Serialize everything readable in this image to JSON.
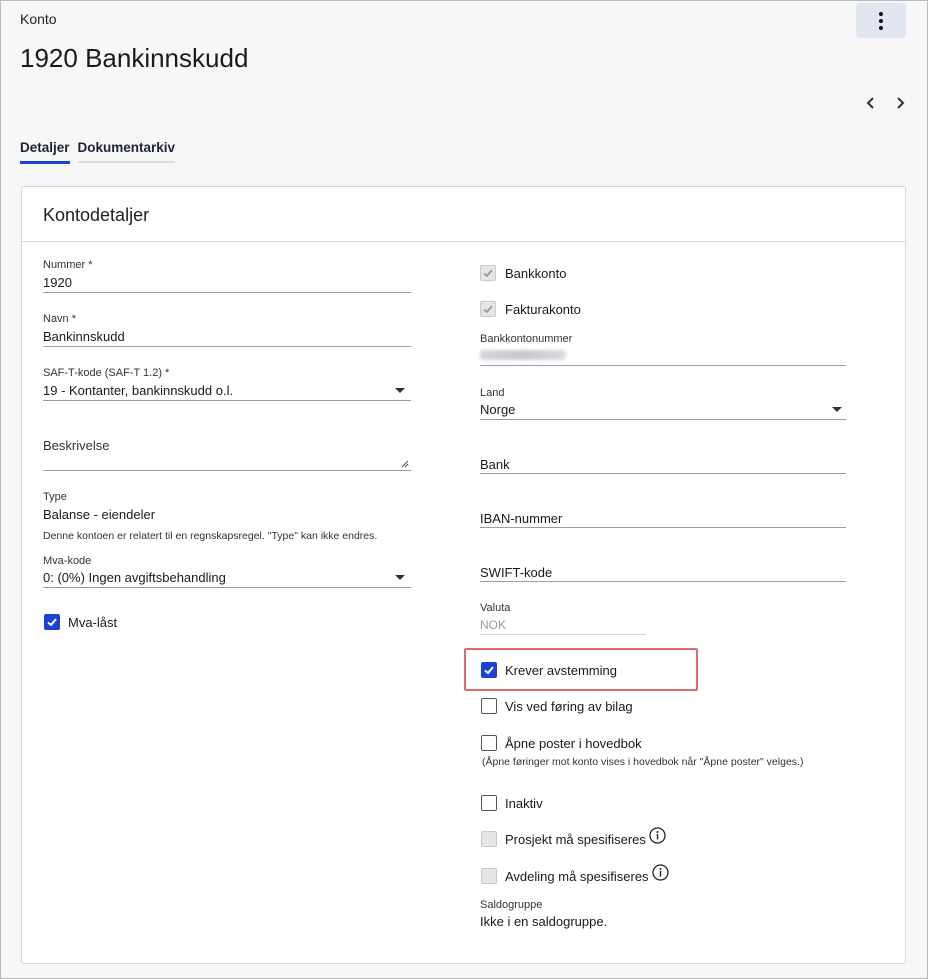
{
  "breadcrumb": "Konto",
  "page_title": "1920 Bankinnskudd",
  "tabs": [
    {
      "label": "Detaljer",
      "active": true
    },
    {
      "label": "Dokumentarkiv",
      "active": false
    }
  ],
  "card_title": "Kontodetaljer",
  "left": {
    "nummer": {
      "label": "Nummer *",
      "value": "1920"
    },
    "navn": {
      "label": "Navn *",
      "value": "Bankinnskudd"
    },
    "saft": {
      "label": "SAF-T-kode (SAF-T 1.2) *",
      "value": "19 - Kontanter, bankinnskudd o.l."
    },
    "beskrivelse": {
      "label": "Beskrivelse",
      "value": ""
    },
    "type": {
      "label": "Type",
      "value": "Balanse - eiendeler",
      "hint": "Denne kontoen er relatert til en regnskapsregel. \"Type\" kan ikke endres."
    },
    "mva": {
      "label": "Mva-kode",
      "value": "0: (0%) Ingen avgiftsbehandling"
    },
    "mva_last": {
      "label": "Mva-låst",
      "checked": true
    }
  },
  "right": {
    "bankkonto": {
      "label": "Bankkonto",
      "checked": true
    },
    "fakturakonto": {
      "label": "Fakturakonto",
      "checked": true
    },
    "bankkontonummer": {
      "label": "Bankkontonummer",
      "value": ""
    },
    "land": {
      "label": "Land",
      "value": "Norge"
    },
    "bank": {
      "placeholder": "Bank"
    },
    "iban": {
      "placeholder": "IBAN-nummer"
    },
    "swift": {
      "placeholder": "SWIFT-kode"
    },
    "valuta": {
      "label": "Valuta",
      "value": "NOK"
    },
    "krever": {
      "label": "Krever avstemming",
      "checked": true
    },
    "vis_ved": {
      "label": "Vis ved føring av bilag",
      "checked": false
    },
    "apne": {
      "label": "Åpne poster i hovedbok",
      "checked": false,
      "hint": "(Åpne føringer mot konto vises i hovedbok når \"Åpne poster\" velges.)"
    },
    "inaktiv": {
      "label": "Inaktiv",
      "checked": false
    },
    "prosjekt": {
      "label": "Prosjekt må spesifiseres",
      "checked": false
    },
    "avdeling": {
      "label": "Avdeling må spesifiseres",
      "checked": false
    },
    "saldogruppe": {
      "label": "Saldogruppe",
      "value": "Ikke i en saldogruppe."
    }
  },
  "colors": {
    "accent": "#1a43d6",
    "highlight": "#e06a72"
  }
}
